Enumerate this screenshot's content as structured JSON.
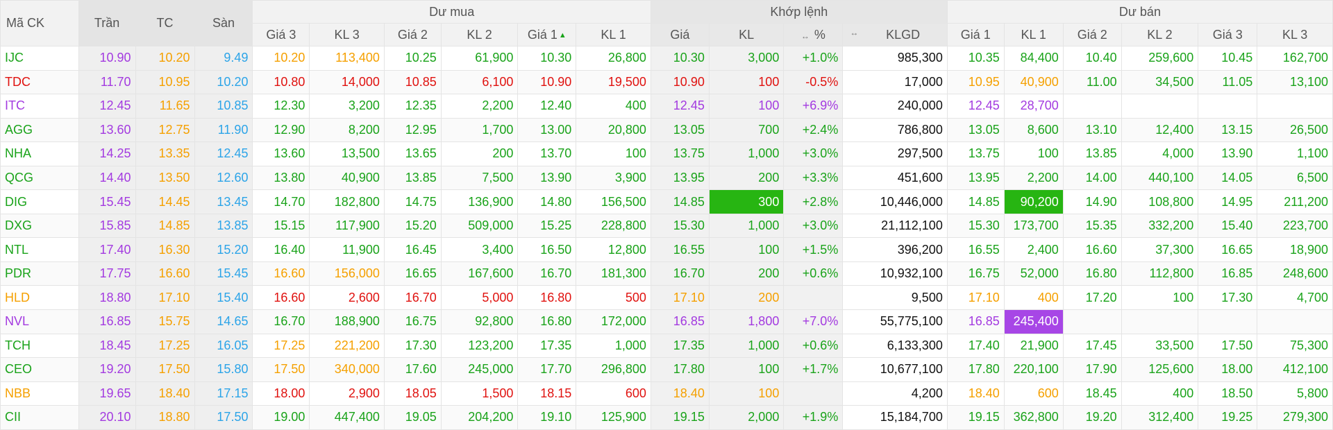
{
  "header": {
    "symbol": "Mã CK",
    "ceiling": "Trần",
    "reference": "TC",
    "floor": "Sàn",
    "buy_group": "Dư mua",
    "match_group": "Khớp lệnh",
    "sell_group": "Dư bán",
    "buy_cols": [
      "Giá 3",
      "KL 3",
      "Giá 2",
      "KL 2",
      "Giá 1",
      "KL 1"
    ],
    "match_cols": [
      "Giá",
      "KL",
      "%",
      "KLGD"
    ],
    "sell_cols": [
      "Giá 1",
      "KL 1",
      "Giá 2",
      "KL 2",
      "Giá 3",
      "KL 3"
    ],
    "sort_icon": "↔",
    "sort_up_icon": "▲"
  },
  "colors": {
    "green": "#1aa31a",
    "red": "#e0120f",
    "yellow": "#f5a000",
    "purple": "#a33ae0",
    "blue": "#2ca4e8",
    "highlight_green": "#27b512",
    "highlight_purple": "#a746e6"
  },
  "rows": [
    {
      "sym": "IJC",
      "sc": "g",
      "ceil": "10.90",
      "ref": "10.20",
      "floor": "9.49",
      "b": [
        [
          "10.20",
          "y"
        ],
        [
          "113,400",
          "y"
        ],
        [
          "10.25",
          "g"
        ],
        [
          "61,900",
          "g"
        ],
        [
          "10.30",
          "g"
        ],
        [
          "26,800",
          "g"
        ]
      ],
      "m": [
        [
          "10.30",
          "g"
        ],
        [
          "3,000",
          "g"
        ],
        [
          "+1.0%",
          "g"
        ]
      ],
      "klgd": "985,300",
      "s": [
        [
          "10.35",
          "g"
        ],
        [
          "84,400",
          "g"
        ],
        [
          "10.40",
          "g"
        ],
        [
          "259,600",
          "g"
        ],
        [
          "10.45",
          "g"
        ],
        [
          "162,700",
          "g"
        ]
      ]
    },
    {
      "sym": "TDC",
      "sc": "r",
      "ceil": "11.70",
      "ref": "10.95",
      "floor": "10.20",
      "b": [
        [
          "10.80",
          "r"
        ],
        [
          "14,000",
          "r"
        ],
        [
          "10.85",
          "r"
        ],
        [
          "6,100",
          "r"
        ],
        [
          "10.90",
          "r"
        ],
        [
          "19,500",
          "r"
        ]
      ],
      "m": [
        [
          "10.90",
          "r"
        ],
        [
          "100",
          "r"
        ],
        [
          "-0.5%",
          "r"
        ]
      ],
      "klgd": "17,000",
      "s": [
        [
          "10.95",
          "y"
        ],
        [
          "40,900",
          "y"
        ],
        [
          "11.00",
          "g"
        ],
        [
          "34,500",
          "g"
        ],
        [
          "11.05",
          "g"
        ],
        [
          "13,100",
          "g"
        ]
      ]
    },
    {
      "sym": "ITC",
      "sc": "p",
      "ceil": "12.45",
      "ref": "11.65",
      "floor": "10.85",
      "b": [
        [
          "12.30",
          "g"
        ],
        [
          "3,200",
          "g"
        ],
        [
          "12.35",
          "g"
        ],
        [
          "2,200",
          "g"
        ],
        [
          "12.40",
          "g"
        ],
        [
          "400",
          "g"
        ]
      ],
      "m": [
        [
          "12.45",
          "p"
        ],
        [
          "100",
          "p"
        ],
        [
          "+6.9%",
          "p"
        ]
      ],
      "klgd": "240,000",
      "s": [
        [
          "12.45",
          "p"
        ],
        [
          "28,700",
          "p"
        ],
        [
          "",
          ""
        ],
        [
          "",
          ""
        ],
        [
          "",
          ""
        ],
        [
          "",
          ""
        ]
      ]
    },
    {
      "sym": "AGG",
      "sc": "g",
      "ceil": "13.60",
      "ref": "12.75",
      "floor": "11.90",
      "b": [
        [
          "12.90",
          "g"
        ],
        [
          "8,200",
          "g"
        ],
        [
          "12.95",
          "g"
        ],
        [
          "1,700",
          "g"
        ],
        [
          "13.00",
          "g"
        ],
        [
          "20,800",
          "g"
        ]
      ],
      "m": [
        [
          "13.05",
          "g"
        ],
        [
          "700",
          "g"
        ],
        [
          "+2.4%",
          "g"
        ]
      ],
      "klgd": "786,800",
      "s": [
        [
          "13.05",
          "g"
        ],
        [
          "8,600",
          "g"
        ],
        [
          "13.10",
          "g"
        ],
        [
          "12,400",
          "g"
        ],
        [
          "13.15",
          "g"
        ],
        [
          "26,500",
          "g"
        ]
      ]
    },
    {
      "sym": "NHA",
      "sc": "g",
      "ceil": "14.25",
      "ref": "13.35",
      "floor": "12.45",
      "b": [
        [
          "13.60",
          "g"
        ],
        [
          "13,500",
          "g"
        ],
        [
          "13.65",
          "g"
        ],
        [
          "200",
          "g"
        ],
        [
          "13.70",
          "g"
        ],
        [
          "100",
          "g"
        ]
      ],
      "m": [
        [
          "13.75",
          "g"
        ],
        [
          "1,000",
          "g"
        ],
        [
          "+3.0%",
          "g"
        ]
      ],
      "klgd": "297,500",
      "s": [
        [
          "13.75",
          "g"
        ],
        [
          "100",
          "g"
        ],
        [
          "13.85",
          "g"
        ],
        [
          "4,000",
          "g"
        ],
        [
          "13.90",
          "g"
        ],
        [
          "1,100",
          "g"
        ]
      ]
    },
    {
      "sym": "QCG",
      "sc": "g",
      "ceil": "14.40",
      "ref": "13.50",
      "floor": "12.60",
      "b": [
        [
          "13.80",
          "g"
        ],
        [
          "40,900",
          "g"
        ],
        [
          "13.85",
          "g"
        ],
        [
          "7,500",
          "g"
        ],
        [
          "13.90",
          "g"
        ],
        [
          "3,900",
          "g"
        ]
      ],
      "m": [
        [
          "13.95",
          "g"
        ],
        [
          "200",
          "g"
        ],
        [
          "+3.3%",
          "g"
        ]
      ],
      "klgd": "451,600",
      "s": [
        [
          "13.95",
          "g"
        ],
        [
          "2,200",
          "g"
        ],
        [
          "14.00",
          "g"
        ],
        [
          "440,100",
          "g"
        ],
        [
          "14.05",
          "g"
        ],
        [
          "6,500",
          "g"
        ]
      ]
    },
    {
      "sym": "DIG",
      "sc": "g",
      "ceil": "15.45",
      "ref": "14.45",
      "floor": "13.45",
      "b": [
        [
          "14.70",
          "g"
        ],
        [
          "182,800",
          "g"
        ],
        [
          "14.75",
          "g"
        ],
        [
          "136,900",
          "g"
        ],
        [
          "14.80",
          "g"
        ],
        [
          "156,500",
          "g"
        ]
      ],
      "m": [
        [
          "14.85",
          "g"
        ],
        [
          "300",
          "hg"
        ],
        [
          "+2.8%",
          "g"
        ]
      ],
      "klgd": "10,446,000",
      "s": [
        [
          "14.85",
          "g"
        ],
        [
          "90,200",
          "hg"
        ],
        [
          "14.90",
          "g"
        ],
        [
          "108,800",
          "g"
        ],
        [
          "14.95",
          "g"
        ],
        [
          "211,200",
          "g"
        ]
      ]
    },
    {
      "sym": "DXG",
      "sc": "g",
      "ceil": "15.85",
      "ref": "14.85",
      "floor": "13.85",
      "b": [
        [
          "15.15",
          "g"
        ],
        [
          "117,900",
          "g"
        ],
        [
          "15.20",
          "g"
        ],
        [
          "509,000",
          "g"
        ],
        [
          "15.25",
          "g"
        ],
        [
          "228,800",
          "g"
        ]
      ],
      "m": [
        [
          "15.30",
          "g"
        ],
        [
          "1,000",
          "g"
        ],
        [
          "+3.0%",
          "g"
        ]
      ],
      "klgd": "21,112,100",
      "s": [
        [
          "15.30",
          "g"
        ],
        [
          "173,700",
          "g"
        ],
        [
          "15.35",
          "g"
        ],
        [
          "332,200",
          "g"
        ],
        [
          "15.40",
          "g"
        ],
        [
          "223,700",
          "g"
        ]
      ]
    },
    {
      "sym": "NTL",
      "sc": "g",
      "ceil": "17.40",
      "ref": "16.30",
      "floor": "15.20",
      "b": [
        [
          "16.40",
          "g"
        ],
        [
          "11,900",
          "g"
        ],
        [
          "16.45",
          "g"
        ],
        [
          "3,400",
          "g"
        ],
        [
          "16.50",
          "g"
        ],
        [
          "12,800",
          "g"
        ]
      ],
      "m": [
        [
          "16.55",
          "g"
        ],
        [
          "100",
          "g"
        ],
        [
          "+1.5%",
          "g"
        ]
      ],
      "klgd": "396,200",
      "s": [
        [
          "16.55",
          "g"
        ],
        [
          "2,400",
          "g"
        ],
        [
          "16.60",
          "g"
        ],
        [
          "37,300",
          "g"
        ],
        [
          "16.65",
          "g"
        ],
        [
          "18,900",
          "g"
        ]
      ]
    },
    {
      "sym": "PDR",
      "sc": "g",
      "ceil": "17.75",
      "ref": "16.60",
      "floor": "15.45",
      "b": [
        [
          "16.60",
          "y"
        ],
        [
          "156,000",
          "y"
        ],
        [
          "16.65",
          "g"
        ],
        [
          "167,600",
          "g"
        ],
        [
          "16.70",
          "g"
        ],
        [
          "181,300",
          "g"
        ]
      ],
      "m": [
        [
          "16.70",
          "g"
        ],
        [
          "200",
          "g"
        ],
        [
          "+0.6%",
          "g"
        ]
      ],
      "klgd": "10,932,100",
      "s": [
        [
          "16.75",
          "g"
        ],
        [
          "52,000",
          "g"
        ],
        [
          "16.80",
          "g"
        ],
        [
          "112,800",
          "g"
        ],
        [
          "16.85",
          "g"
        ],
        [
          "248,600",
          "g"
        ]
      ]
    },
    {
      "sym": "HLD",
      "sc": "y",
      "ceil": "18.80",
      "ref": "17.10",
      "floor": "15.40",
      "b": [
        [
          "16.60",
          "r"
        ],
        [
          "2,600",
          "r"
        ],
        [
          "16.70",
          "r"
        ],
        [
          "5,000",
          "r"
        ],
        [
          "16.80",
          "r"
        ],
        [
          "500",
          "r"
        ]
      ],
      "m": [
        [
          "17.10",
          "y"
        ],
        [
          "200",
          "y"
        ],
        [
          "",
          "y"
        ]
      ],
      "klgd": "9,500",
      "s": [
        [
          "17.10",
          "y"
        ],
        [
          "400",
          "y"
        ],
        [
          "17.20",
          "g"
        ],
        [
          "100",
          "g"
        ],
        [
          "17.30",
          "g"
        ],
        [
          "4,700",
          "g"
        ]
      ]
    },
    {
      "sym": "NVL",
      "sc": "p",
      "ceil": "16.85",
      "ref": "15.75",
      "floor": "14.65",
      "b": [
        [
          "16.70",
          "g"
        ],
        [
          "188,900",
          "g"
        ],
        [
          "16.75",
          "g"
        ],
        [
          "92,800",
          "g"
        ],
        [
          "16.80",
          "g"
        ],
        [
          "172,000",
          "g"
        ]
      ],
      "m": [
        [
          "16.85",
          "p"
        ],
        [
          "1,800",
          "p"
        ],
        [
          "+7.0%",
          "p"
        ]
      ],
      "klgd": "55,775,100",
      "s": [
        [
          "16.85",
          "p"
        ],
        [
          "245,400",
          "hp"
        ],
        [
          "",
          ""
        ],
        [
          "",
          ""
        ],
        [
          "",
          ""
        ],
        [
          "",
          ""
        ]
      ]
    },
    {
      "sym": "TCH",
      "sc": "g",
      "ceil": "18.45",
      "ref": "17.25",
      "floor": "16.05",
      "b": [
        [
          "17.25",
          "y"
        ],
        [
          "221,200",
          "y"
        ],
        [
          "17.30",
          "g"
        ],
        [
          "123,200",
          "g"
        ],
        [
          "17.35",
          "g"
        ],
        [
          "1,000",
          "g"
        ]
      ],
      "m": [
        [
          "17.35",
          "g"
        ],
        [
          "1,000",
          "g"
        ],
        [
          "+0.6%",
          "g"
        ]
      ],
      "klgd": "6,133,300",
      "s": [
        [
          "17.40",
          "g"
        ],
        [
          "21,900",
          "g"
        ],
        [
          "17.45",
          "g"
        ],
        [
          "33,500",
          "g"
        ],
        [
          "17.50",
          "g"
        ],
        [
          "75,300",
          "g"
        ]
      ]
    },
    {
      "sym": "CEO",
      "sc": "g",
      "ceil": "19.20",
      "ref": "17.50",
      "floor": "15.80",
      "b": [
        [
          "17.50",
          "y"
        ],
        [
          "340,000",
          "y"
        ],
        [
          "17.60",
          "g"
        ],
        [
          "245,000",
          "g"
        ],
        [
          "17.70",
          "g"
        ],
        [
          "296,800",
          "g"
        ]
      ],
      "m": [
        [
          "17.80",
          "g"
        ],
        [
          "100",
          "g"
        ],
        [
          "+1.7%",
          "g"
        ]
      ],
      "klgd": "10,677,100",
      "s": [
        [
          "17.80",
          "g"
        ],
        [
          "220,100",
          "g"
        ],
        [
          "17.90",
          "g"
        ],
        [
          "125,600",
          "g"
        ],
        [
          "18.00",
          "g"
        ],
        [
          "412,100",
          "g"
        ]
      ]
    },
    {
      "sym": "NBB",
      "sc": "y",
      "ceil": "19.65",
      "ref": "18.40",
      "floor": "17.15",
      "b": [
        [
          "18.00",
          "r"
        ],
        [
          "2,900",
          "r"
        ],
        [
          "18.05",
          "r"
        ],
        [
          "1,500",
          "r"
        ],
        [
          "18.15",
          "r"
        ],
        [
          "600",
          "r"
        ]
      ],
      "m": [
        [
          "18.40",
          "y"
        ],
        [
          "100",
          "y"
        ],
        [
          "",
          "y"
        ]
      ],
      "klgd": "4,200",
      "s": [
        [
          "18.40",
          "y"
        ],
        [
          "600",
          "y"
        ],
        [
          "18.45",
          "g"
        ],
        [
          "400",
          "g"
        ],
        [
          "18.50",
          "g"
        ],
        [
          "5,800",
          "g"
        ]
      ]
    },
    {
      "sym": "CII",
      "sc": "g",
      "ceil": "20.10",
      "ref": "18.80",
      "floor": "17.50",
      "b": [
        [
          "19.00",
          "g"
        ],
        [
          "447,400",
          "g"
        ],
        [
          "19.05",
          "g"
        ],
        [
          "204,200",
          "g"
        ],
        [
          "19.10",
          "g"
        ],
        [
          "125,900",
          "g"
        ]
      ],
      "m": [
        [
          "19.15",
          "g"
        ],
        [
          "2,000",
          "g"
        ],
        [
          "+1.9%",
          "g"
        ]
      ],
      "klgd": "15,184,700",
      "s": [
        [
          "19.15",
          "g"
        ],
        [
          "362,800",
          "g"
        ],
        [
          "19.20",
          "g"
        ],
        [
          "312,400",
          "g"
        ],
        [
          "19.25",
          "g"
        ],
        [
          "279,300",
          "g"
        ]
      ]
    }
  ]
}
